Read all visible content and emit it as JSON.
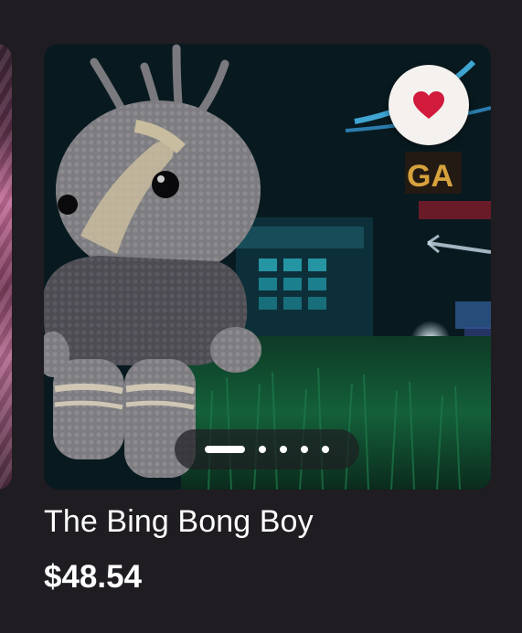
{
  "product": {
    "title": "The Bing Bong Boy",
    "price": "$48.54",
    "image_alt": "Crocheted grey doll with antennae in front of a neon-lit scene",
    "background_sign_text": "GA"
  },
  "favorite": {
    "icon": "heart-icon",
    "active": true,
    "color": "#d11a3c"
  },
  "gallery": {
    "total_images": 5,
    "current_index": 0
  },
  "colors": {
    "page_background": "#1f1c22",
    "text": "#ffffff",
    "favorite_button_bg": "#f4f1ee"
  }
}
